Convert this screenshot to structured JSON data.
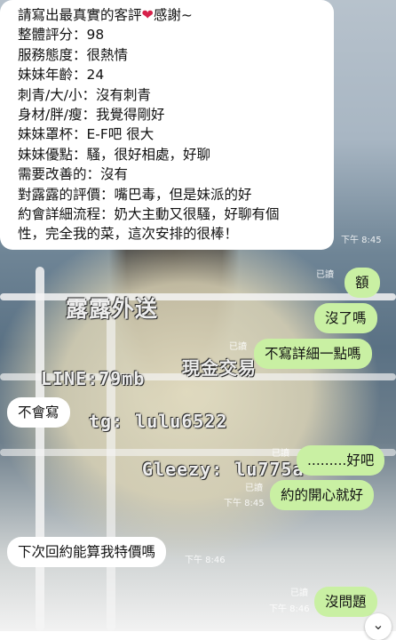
{
  "messages": {
    "review": {
      "line1_prefix": "請寫出最真實的客評",
      "line1_suffix": "感謝~",
      "lines": [
        "整體評分：98",
        "服務態度：很熱情",
        "妹妹年齡：24",
        "刺青/大/小：沒有刺青",
        "身材/胖/瘦：我覺得剛好",
        "妹妹罩杯：E-F吧 很大",
        "妹妹優點：騷，很好相處，好聊",
        "需要改善的：沒有",
        "對露露的評價：嘴巴毒，但是妹派的好",
        "約會詳細流程：奶大主動又很騷，好聊有個",
        "性，完全我的菜，這次安排的很棒！"
      ],
      "time": "下午 8:45"
    },
    "out1": {
      "text": "額",
      "read": "已讀"
    },
    "out2": {
      "text": "沒了嗎"
    },
    "out3": {
      "text": "不寫詳細一點嗎",
      "read": "已讀"
    },
    "in1": {
      "text": "不會寫"
    },
    "out4": {
      "text": ".........好吧",
      "read": "已讀"
    },
    "out5": {
      "text": "約的開心就好",
      "read": "已讀",
      "time": "下午 8:45"
    },
    "in2": {
      "text": "下次回約能算我特價嗎",
      "time": "下午 8:46"
    },
    "out6": {
      "text": "沒問題",
      "read": "已讀",
      "time": "下午 8:46"
    }
  },
  "watermark": {
    "brand": "露露外送",
    "tag": "現金交易",
    "line": "LINE:79mb",
    "tg": "tg: lulu6522",
    "gleezy": "Gleezy: lu775a"
  },
  "icons": {
    "heart": "heart-icon",
    "scroll": "chevron-down-icon"
  },
  "colors": {
    "outgoing": "#c9f0a3",
    "incoming": "#ffffff",
    "heart": "#d6214a"
  }
}
